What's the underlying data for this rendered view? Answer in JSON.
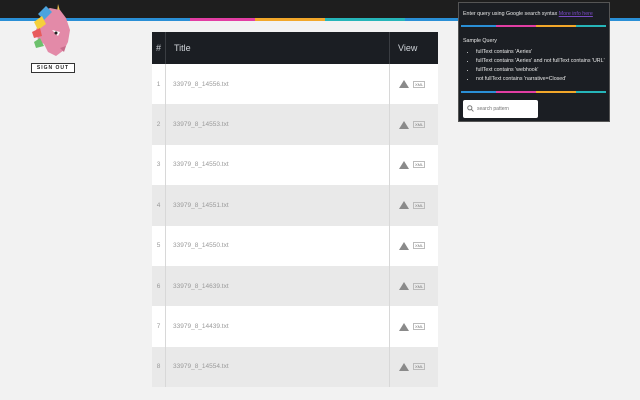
{
  "header": {
    "sign_out_label": "SIGN OUT"
  },
  "colors": {
    "rainbow": [
      "#2a8fd6",
      "#e23ea3",
      "#f2a72a",
      "#26b5b9"
    ],
    "header_bg": "#1e1e1e",
    "table_header_bg": "#1b1e23",
    "link": "#7a4ac6"
  },
  "table": {
    "columns": [
      "#",
      "Title",
      "View"
    ],
    "rows": [
      {
        "num": "1",
        "title": "33979_8_14556.txt"
      },
      {
        "num": "2",
        "title": "33979_8_14553.txt"
      },
      {
        "num": "3",
        "title": "33979_8_14550.txt"
      },
      {
        "num": "4",
        "title": "33979_8_14551.txt"
      },
      {
        "num": "5",
        "title": "33979_8_14550.txt"
      },
      {
        "num": "6",
        "title": "33979_8_14639.txt"
      },
      {
        "num": "7",
        "title": "33979_8_14439.txt"
      },
      {
        "num": "8",
        "title": "33979_8_14554.txt"
      }
    ],
    "view_icons": [
      "drive-icon",
      "xml-icon"
    ]
  },
  "popup": {
    "intro": "Enter query using Google search syntax",
    "intro_link": "More info here",
    "sample_title": "Sample Query",
    "samples": [
      "fullText contains 'Aeries'",
      "fullText contains 'Aeries' and not fullText contains 'URL'",
      "fullText contains 'webhook'",
      "not fullText contains 'narrative=Closed'"
    ],
    "search_placeholder": "search pattern",
    "search_icon": "search-icon"
  }
}
